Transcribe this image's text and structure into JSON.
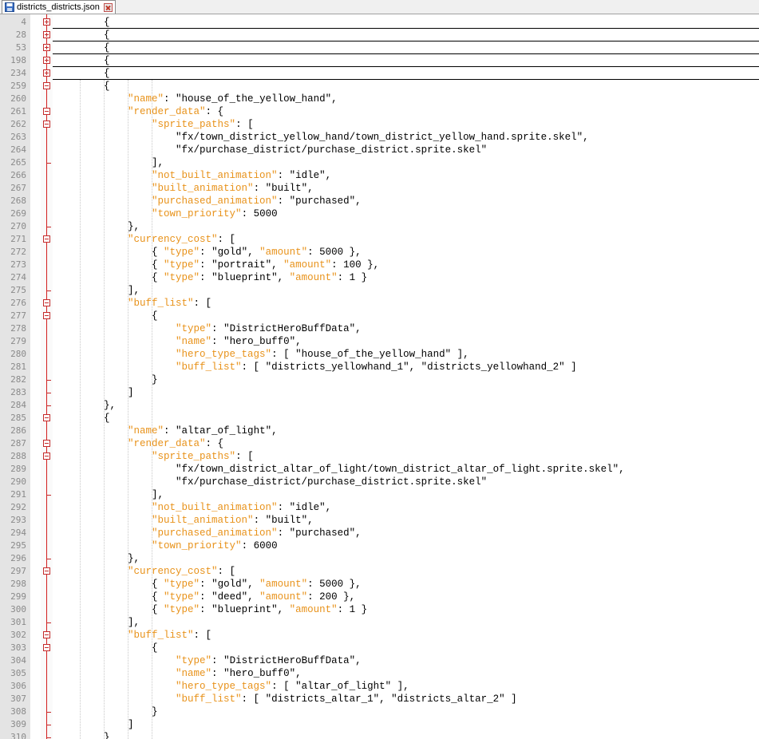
{
  "tab": {
    "filename": "districts_districts.json",
    "icon": "file-save-icon",
    "close_icon": "close-icon"
  },
  "colors": {
    "key": "#e8921a",
    "string": "#000000",
    "fold_marker": "#c42a2a",
    "gutter_bg": "#e4e4e4",
    "line_number": "#8a8a8a"
  },
  "lines": [
    {
      "n": "4",
      "fold": "plus",
      "collapsed": true,
      "t": [
        {
          "c": "p",
          "v": "        {"
        }
      ]
    },
    {
      "n": "28",
      "fold": "plus",
      "collapsed": true,
      "t": [
        {
          "c": "p",
          "v": "        {"
        }
      ]
    },
    {
      "n": "53",
      "fold": "plus",
      "collapsed": true,
      "t": [
        {
          "c": "p",
          "v": "        {"
        }
      ]
    },
    {
      "n": "198",
      "fold": "plus",
      "collapsed": true,
      "t": [
        {
          "c": "p",
          "v": "        {"
        }
      ]
    },
    {
      "n": "234",
      "fold": "plus",
      "collapsed": true,
      "t": [
        {
          "c": "p",
          "v": "        {"
        }
      ]
    },
    {
      "n": "259",
      "fold": "minus",
      "t": [
        {
          "c": "p",
          "v": "        {"
        }
      ]
    },
    {
      "n": "260",
      "t": [
        {
          "c": "p",
          "v": "            "
        },
        {
          "c": "k",
          "v": "\"name\""
        },
        {
          "c": "p",
          "v": ": "
        },
        {
          "c": "s",
          "v": "\"house_of_the_yellow_hand\""
        },
        {
          "c": "p",
          "v": ","
        }
      ]
    },
    {
      "n": "261",
      "fold": "minus",
      "t": [
        {
          "c": "p",
          "v": "            "
        },
        {
          "c": "k",
          "v": "\"render_data\""
        },
        {
          "c": "p",
          "v": ": {"
        }
      ]
    },
    {
      "n": "262",
      "fold": "minus",
      "t": [
        {
          "c": "p",
          "v": "                "
        },
        {
          "c": "k",
          "v": "\"sprite_paths\""
        },
        {
          "c": "p",
          "v": ": ["
        }
      ]
    },
    {
      "n": "263",
      "t": [
        {
          "c": "p",
          "v": "                    "
        },
        {
          "c": "s",
          "v": "\"fx/town_district_yellow_hand/town_district_yellow_hand.sprite.skel\""
        },
        {
          "c": "p",
          "v": ","
        }
      ]
    },
    {
      "n": "264",
      "t": [
        {
          "c": "p",
          "v": "                    "
        },
        {
          "c": "s",
          "v": "\"fx/purchase_district/purchase_district.sprite.skel\""
        }
      ]
    },
    {
      "n": "265",
      "tick": true,
      "t": [
        {
          "c": "p",
          "v": "                ],"
        }
      ]
    },
    {
      "n": "266",
      "t": [
        {
          "c": "p",
          "v": "                "
        },
        {
          "c": "k",
          "v": "\"not_built_animation\""
        },
        {
          "c": "p",
          "v": ": "
        },
        {
          "c": "s",
          "v": "\"idle\""
        },
        {
          "c": "p",
          "v": ","
        }
      ]
    },
    {
      "n": "267",
      "t": [
        {
          "c": "p",
          "v": "                "
        },
        {
          "c": "k",
          "v": "\"built_animation\""
        },
        {
          "c": "p",
          "v": ": "
        },
        {
          "c": "s",
          "v": "\"built\""
        },
        {
          "c": "p",
          "v": ","
        }
      ]
    },
    {
      "n": "268",
      "t": [
        {
          "c": "p",
          "v": "                "
        },
        {
          "c": "k",
          "v": "\"purchased_animation\""
        },
        {
          "c": "p",
          "v": ": "
        },
        {
          "c": "s",
          "v": "\"purchased\""
        },
        {
          "c": "p",
          "v": ","
        }
      ]
    },
    {
      "n": "269",
      "t": [
        {
          "c": "p",
          "v": "                "
        },
        {
          "c": "k",
          "v": "\"town_priority\""
        },
        {
          "c": "p",
          "v": ": 5000"
        }
      ]
    },
    {
      "n": "270",
      "tick": true,
      "t": [
        {
          "c": "p",
          "v": "            },"
        }
      ]
    },
    {
      "n": "271",
      "fold": "minus",
      "t": [
        {
          "c": "p",
          "v": "            "
        },
        {
          "c": "k",
          "v": "\"currency_cost\""
        },
        {
          "c": "p",
          "v": ": ["
        }
      ]
    },
    {
      "n": "272",
      "t": [
        {
          "c": "p",
          "v": "                { "
        },
        {
          "c": "k",
          "v": "\"type\""
        },
        {
          "c": "p",
          "v": ": "
        },
        {
          "c": "s",
          "v": "\"gold\""
        },
        {
          "c": "p",
          "v": ", "
        },
        {
          "c": "k",
          "v": "\"amount\""
        },
        {
          "c": "p",
          "v": ": 5000 },"
        }
      ]
    },
    {
      "n": "273",
      "t": [
        {
          "c": "p",
          "v": "                { "
        },
        {
          "c": "k",
          "v": "\"type\""
        },
        {
          "c": "p",
          "v": ": "
        },
        {
          "c": "s",
          "v": "\"portrait\""
        },
        {
          "c": "p",
          "v": ", "
        },
        {
          "c": "k",
          "v": "\"amount\""
        },
        {
          "c": "p",
          "v": ": 100 },"
        }
      ]
    },
    {
      "n": "274",
      "t": [
        {
          "c": "p",
          "v": "                { "
        },
        {
          "c": "k",
          "v": "\"type\""
        },
        {
          "c": "p",
          "v": ": "
        },
        {
          "c": "s",
          "v": "\"blueprint\""
        },
        {
          "c": "p",
          "v": ", "
        },
        {
          "c": "k",
          "v": "\"amount\""
        },
        {
          "c": "p",
          "v": ": 1 }"
        }
      ]
    },
    {
      "n": "275",
      "tick": true,
      "t": [
        {
          "c": "p",
          "v": "            ],"
        }
      ]
    },
    {
      "n": "276",
      "fold": "minus",
      "t": [
        {
          "c": "p",
          "v": "            "
        },
        {
          "c": "k",
          "v": "\"buff_list\""
        },
        {
          "c": "p",
          "v": ": ["
        }
      ]
    },
    {
      "n": "277",
      "fold": "minus",
      "t": [
        {
          "c": "p",
          "v": "                {"
        }
      ]
    },
    {
      "n": "278",
      "t": [
        {
          "c": "p",
          "v": "                    "
        },
        {
          "c": "k",
          "v": "\"type\""
        },
        {
          "c": "p",
          "v": ": "
        },
        {
          "c": "s",
          "v": "\"DistrictHeroBuffData\""
        },
        {
          "c": "p",
          "v": ","
        }
      ]
    },
    {
      "n": "279",
      "t": [
        {
          "c": "p",
          "v": "                    "
        },
        {
          "c": "k",
          "v": "\"name\""
        },
        {
          "c": "p",
          "v": ": "
        },
        {
          "c": "s",
          "v": "\"hero_buff0\""
        },
        {
          "c": "p",
          "v": ","
        }
      ]
    },
    {
      "n": "280",
      "t": [
        {
          "c": "p",
          "v": "                    "
        },
        {
          "c": "k",
          "v": "\"hero_type_tags\""
        },
        {
          "c": "p",
          "v": ": [ "
        },
        {
          "c": "s",
          "v": "\"house_of_the_yellow_hand\""
        },
        {
          "c": "p",
          "v": " ],"
        }
      ]
    },
    {
      "n": "281",
      "t": [
        {
          "c": "p",
          "v": "                    "
        },
        {
          "c": "k",
          "v": "\"buff_list\""
        },
        {
          "c": "p",
          "v": ": [ "
        },
        {
          "c": "s",
          "v": "\"districts_yellowhand_1\""
        },
        {
          "c": "p",
          "v": ", "
        },
        {
          "c": "s",
          "v": "\"districts_yellowhand_2\""
        },
        {
          "c": "p",
          "v": " ]"
        }
      ]
    },
    {
      "n": "282",
      "tick": true,
      "t": [
        {
          "c": "p",
          "v": "                }"
        }
      ]
    },
    {
      "n": "283",
      "tick": true,
      "t": [
        {
          "c": "p",
          "v": "            ]"
        }
      ]
    },
    {
      "n": "284",
      "tick": true,
      "t": [
        {
          "c": "p",
          "v": "        },"
        }
      ]
    },
    {
      "n": "285",
      "fold": "minus",
      "t": [
        {
          "c": "p",
          "v": "        {"
        }
      ]
    },
    {
      "n": "286",
      "t": [
        {
          "c": "p",
          "v": "            "
        },
        {
          "c": "k",
          "v": "\"name\""
        },
        {
          "c": "p",
          "v": ": "
        },
        {
          "c": "s",
          "v": "\"altar_of_light\""
        },
        {
          "c": "p",
          "v": ","
        }
      ]
    },
    {
      "n": "287",
      "fold": "minus",
      "t": [
        {
          "c": "p",
          "v": "            "
        },
        {
          "c": "k",
          "v": "\"render_data\""
        },
        {
          "c": "p",
          "v": ": {"
        }
      ]
    },
    {
      "n": "288",
      "fold": "minus",
      "t": [
        {
          "c": "p",
          "v": "                "
        },
        {
          "c": "k",
          "v": "\"sprite_paths\""
        },
        {
          "c": "p",
          "v": ": ["
        }
      ]
    },
    {
      "n": "289",
      "t": [
        {
          "c": "p",
          "v": "                    "
        },
        {
          "c": "s",
          "v": "\"fx/town_district_altar_of_light/town_district_altar_of_light.sprite.skel\""
        },
        {
          "c": "p",
          "v": ","
        }
      ]
    },
    {
      "n": "290",
      "t": [
        {
          "c": "p",
          "v": "                    "
        },
        {
          "c": "s",
          "v": "\"fx/purchase_district/purchase_district.sprite.skel\""
        }
      ]
    },
    {
      "n": "291",
      "tick": true,
      "t": [
        {
          "c": "p",
          "v": "                ],"
        }
      ]
    },
    {
      "n": "292",
      "t": [
        {
          "c": "p",
          "v": "                "
        },
        {
          "c": "k",
          "v": "\"not_built_animation\""
        },
        {
          "c": "p",
          "v": ": "
        },
        {
          "c": "s",
          "v": "\"idle\""
        },
        {
          "c": "p",
          "v": ","
        }
      ]
    },
    {
      "n": "293",
      "t": [
        {
          "c": "p",
          "v": "                "
        },
        {
          "c": "k",
          "v": "\"built_animation\""
        },
        {
          "c": "p",
          "v": ": "
        },
        {
          "c": "s",
          "v": "\"built\""
        },
        {
          "c": "p",
          "v": ","
        }
      ]
    },
    {
      "n": "294",
      "t": [
        {
          "c": "p",
          "v": "                "
        },
        {
          "c": "k",
          "v": "\"purchased_animation\""
        },
        {
          "c": "p",
          "v": ": "
        },
        {
          "c": "s",
          "v": "\"purchased\""
        },
        {
          "c": "p",
          "v": ","
        }
      ]
    },
    {
      "n": "295",
      "t": [
        {
          "c": "p",
          "v": "                "
        },
        {
          "c": "k",
          "v": "\"town_priority\""
        },
        {
          "c": "p",
          "v": ": 6000"
        }
      ]
    },
    {
      "n": "296",
      "tick": true,
      "t": [
        {
          "c": "p",
          "v": "            },"
        }
      ]
    },
    {
      "n": "297",
      "fold": "minus",
      "t": [
        {
          "c": "p",
          "v": "            "
        },
        {
          "c": "k",
          "v": "\"currency_cost\""
        },
        {
          "c": "p",
          "v": ": ["
        }
      ]
    },
    {
      "n": "298",
      "t": [
        {
          "c": "p",
          "v": "                { "
        },
        {
          "c": "k",
          "v": "\"type\""
        },
        {
          "c": "p",
          "v": ": "
        },
        {
          "c": "s",
          "v": "\"gold\""
        },
        {
          "c": "p",
          "v": ", "
        },
        {
          "c": "k",
          "v": "\"amount\""
        },
        {
          "c": "p",
          "v": ": 5000 },"
        }
      ]
    },
    {
      "n": "299",
      "t": [
        {
          "c": "p",
          "v": "                { "
        },
        {
          "c": "k",
          "v": "\"type\""
        },
        {
          "c": "p",
          "v": ": "
        },
        {
          "c": "s",
          "v": "\"deed\""
        },
        {
          "c": "p",
          "v": ", "
        },
        {
          "c": "k",
          "v": "\"amount\""
        },
        {
          "c": "p",
          "v": ": 200 },"
        }
      ]
    },
    {
      "n": "300",
      "t": [
        {
          "c": "p",
          "v": "                { "
        },
        {
          "c": "k",
          "v": "\"type\""
        },
        {
          "c": "p",
          "v": ": "
        },
        {
          "c": "s",
          "v": "\"blueprint\""
        },
        {
          "c": "p",
          "v": ", "
        },
        {
          "c": "k",
          "v": "\"amount\""
        },
        {
          "c": "p",
          "v": ": 1 }"
        }
      ]
    },
    {
      "n": "301",
      "tick": true,
      "t": [
        {
          "c": "p",
          "v": "            ],"
        }
      ]
    },
    {
      "n": "302",
      "fold": "minus",
      "t": [
        {
          "c": "p",
          "v": "            "
        },
        {
          "c": "k",
          "v": "\"buff_list\""
        },
        {
          "c": "p",
          "v": ": ["
        }
      ]
    },
    {
      "n": "303",
      "fold": "minus",
      "t": [
        {
          "c": "p",
          "v": "                {"
        }
      ]
    },
    {
      "n": "304",
      "t": [
        {
          "c": "p",
          "v": "                    "
        },
        {
          "c": "k",
          "v": "\"type\""
        },
        {
          "c": "p",
          "v": ": "
        },
        {
          "c": "s",
          "v": "\"DistrictHeroBuffData\""
        },
        {
          "c": "p",
          "v": ","
        }
      ]
    },
    {
      "n": "305",
      "t": [
        {
          "c": "p",
          "v": "                    "
        },
        {
          "c": "k",
          "v": "\"name\""
        },
        {
          "c": "p",
          "v": ": "
        },
        {
          "c": "s",
          "v": "\"hero_buff0\""
        },
        {
          "c": "p",
          "v": ","
        }
      ]
    },
    {
      "n": "306",
      "t": [
        {
          "c": "p",
          "v": "                    "
        },
        {
          "c": "k",
          "v": "\"hero_type_tags\""
        },
        {
          "c": "p",
          "v": ": [ "
        },
        {
          "c": "s",
          "v": "\"altar_of_light\""
        },
        {
          "c": "p",
          "v": " ],"
        }
      ]
    },
    {
      "n": "307",
      "t": [
        {
          "c": "p",
          "v": "                    "
        },
        {
          "c": "k",
          "v": "\"buff_list\""
        },
        {
          "c": "p",
          "v": ": [ "
        },
        {
          "c": "s",
          "v": "\"districts_altar_1\""
        },
        {
          "c": "p",
          "v": ", "
        },
        {
          "c": "s",
          "v": "\"districts_altar_2\""
        },
        {
          "c": "p",
          "v": " ]"
        }
      ]
    },
    {
      "n": "308",
      "tick": true,
      "t": [
        {
          "c": "p",
          "v": "                }"
        }
      ]
    },
    {
      "n": "309",
      "tick": true,
      "t": [
        {
          "c": "p",
          "v": "            ]"
        }
      ]
    },
    {
      "n": "310",
      "tick": true,
      "t": [
        {
          "c": "p",
          "v": "        }"
        }
      ]
    }
  ]
}
